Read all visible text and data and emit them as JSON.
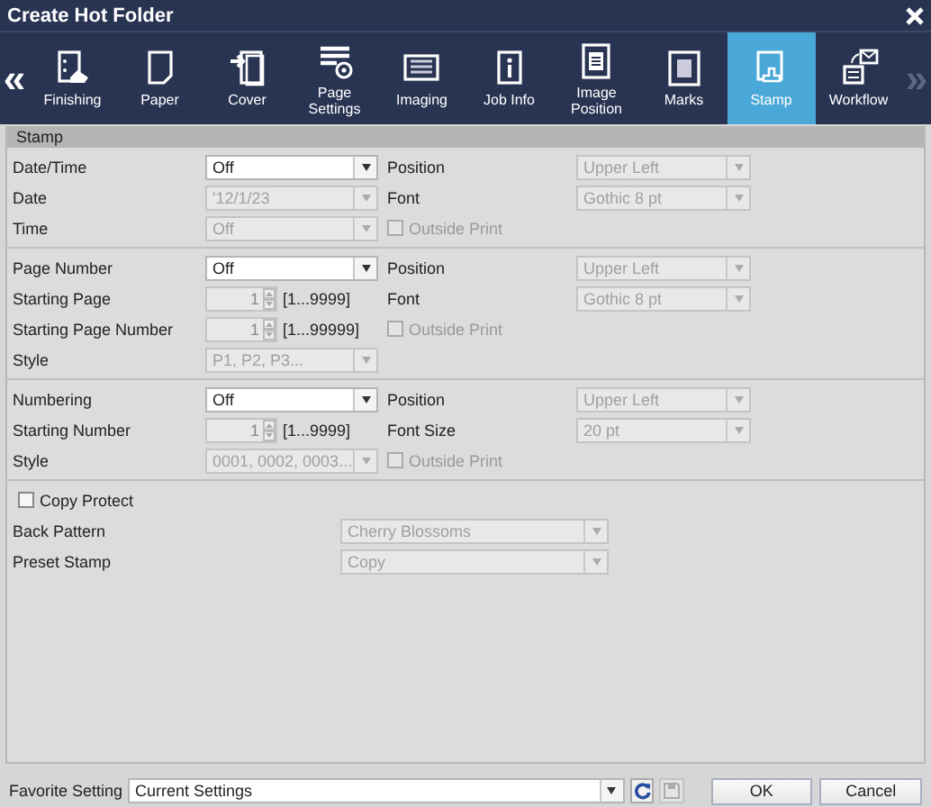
{
  "window": {
    "title": "Create Hot Folder"
  },
  "nav_prev": {
    "glyph": "«",
    "disabled": false
  },
  "nav_next": {
    "glyph": "»",
    "disabled": true
  },
  "tabs": [
    {
      "label": "Finishing",
      "selected": false
    },
    {
      "label": "Paper",
      "selected": false
    },
    {
      "label": "Cover",
      "selected": false
    },
    {
      "label": "Page Settings",
      "selected": false
    },
    {
      "label": "Imaging",
      "selected": false
    },
    {
      "label": "Job Info",
      "selected": false
    },
    {
      "label": "Image Position",
      "selected": false
    },
    {
      "label": "Marks",
      "selected": false
    },
    {
      "label": "Stamp",
      "selected": true
    },
    {
      "label": "Workflow",
      "selected": false
    }
  ],
  "section": {
    "title": "Stamp"
  },
  "groups": [
    {
      "kind": "stamp",
      "rows": [
        {
          "label": "Date/Time",
          "field": {
            "kind": "select",
            "value": "Off",
            "disabled": false
          },
          "side": {
            "kind": "select",
            "label": "Position",
            "value": "Upper Left",
            "disabled": true
          }
        },
        {
          "label": "Date",
          "field": {
            "kind": "select",
            "value": "'12/1/23",
            "disabled": true
          },
          "side": {
            "kind": "select",
            "label": "Font",
            "value": "Gothic 8 pt",
            "disabled": true
          }
        },
        {
          "label": "Time",
          "field": {
            "kind": "select",
            "value": "Off",
            "disabled": true
          },
          "side": {
            "kind": "checkbox",
            "label": "Outside Print",
            "checked": false,
            "disabled": true
          }
        }
      ]
    },
    {
      "kind": "stamp",
      "rows": [
        {
          "label": "Page Number",
          "field": {
            "kind": "select",
            "value": "Off",
            "disabled": false
          },
          "side": {
            "kind": "select",
            "label": "Position",
            "value": "Upper Left",
            "disabled": true
          }
        },
        {
          "label": "Starting Page",
          "field": {
            "kind": "spin",
            "value": "1",
            "range": "[1...9999]",
            "disabled": true
          },
          "side": {
            "kind": "select",
            "label": "Font",
            "value": "Gothic 8 pt",
            "disabled": true
          }
        },
        {
          "label": "Starting Page Number",
          "field": {
            "kind": "spin",
            "value": "1",
            "range": "[1...99999]",
            "disabled": true
          },
          "side": {
            "kind": "checkbox",
            "label": "Outside Print",
            "checked": false,
            "disabled": true
          }
        },
        {
          "label": "Style",
          "field": {
            "kind": "select",
            "value": "P1, P2, P3...",
            "disabled": true
          }
        }
      ]
    },
    {
      "kind": "stamp",
      "rows": [
        {
          "label": "Numbering",
          "field": {
            "kind": "select",
            "value": "Off",
            "disabled": false
          },
          "side": {
            "kind": "select",
            "label": "Position",
            "value": "Upper Left",
            "disabled": true
          }
        },
        {
          "label": "Starting Number",
          "field": {
            "kind": "spin",
            "value": "1",
            "range": "[1...9999]",
            "disabled": true
          },
          "side": {
            "kind": "select",
            "label": "Font Size",
            "value": "20 pt",
            "disabled": true
          }
        },
        {
          "label": "Style",
          "field": {
            "kind": "select",
            "value": "0001, 0002, 0003...",
            "disabled": true
          },
          "side": {
            "kind": "checkbox",
            "label": "Outside Print",
            "checked": false,
            "disabled": true
          }
        }
      ]
    },
    {
      "kind": "protect",
      "rows": [
        {
          "field": {
            "kind": "checkbox",
            "label": "Copy Protect",
            "checked": false,
            "disabled": false
          }
        },
        {
          "label": "Back Pattern",
          "field": {
            "kind": "select",
            "value": "Cherry Blossoms",
            "disabled": true
          }
        },
        {
          "label": "Preset Stamp",
          "field": {
            "kind": "select",
            "value": "Copy",
            "disabled": true
          }
        }
      ]
    }
  ],
  "footer": {
    "label": "Favorite Setting",
    "select": {
      "value": "Current Settings",
      "disabled": false
    },
    "refresh": {
      "disabled": false
    },
    "save": {
      "disabled": true
    },
    "buttons": [
      "OK",
      "Cancel"
    ]
  }
}
